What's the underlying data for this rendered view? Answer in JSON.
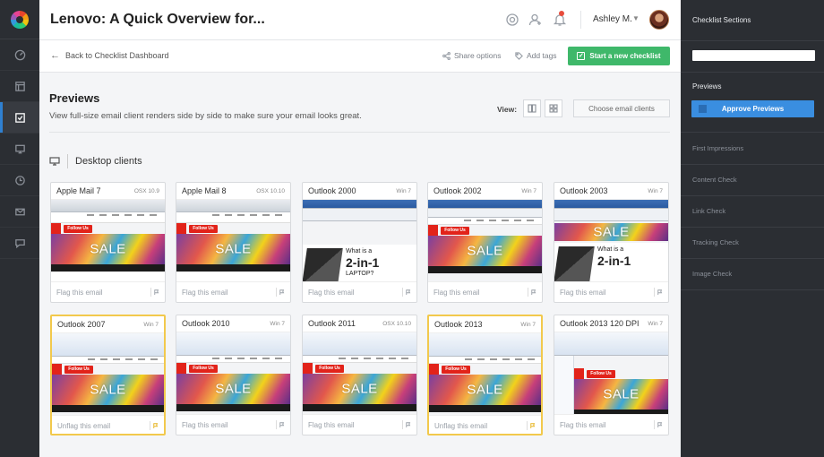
{
  "app": {
    "title": "Lenovo: A Quick Overview for..."
  },
  "header": {
    "user_name": "Ashley M."
  },
  "subbar": {
    "back_label": "Back to Checklist Dashboard",
    "share_label": "Share options",
    "tags_label": "Add tags",
    "start_label": "Start a new checklist"
  },
  "main": {
    "heading": "Previews",
    "description": "View full-size email client renders side by side to make sure your email looks great.",
    "view_label": "View:",
    "choose_label": "Choose email clients",
    "section_label": "Desktop clients"
  },
  "cards": [
    {
      "name": "Apple Mail 7",
      "os": "OSX 10.9",
      "flag": "Flag this email",
      "flagged": false,
      "variant": "mac"
    },
    {
      "name": "Apple Mail 8",
      "os": "OSX 10.10",
      "flag": "Flag this email",
      "flagged": false,
      "variant": "mac"
    },
    {
      "name": "Outlook 2000",
      "os": "Win 7",
      "flag": "Flag this email",
      "flagged": false,
      "variant": "laptop"
    },
    {
      "name": "Outlook 2002",
      "os": "Win 7",
      "flag": "Flag this email",
      "flagged": false,
      "variant": "win"
    },
    {
      "name": "Outlook 2003",
      "os": "Win 7",
      "flag": "Flag this email",
      "flagged": false,
      "variant": "salelaptop"
    },
    {
      "name": "Outlook 2007",
      "os": "Win 7",
      "flag": "Unflag this email",
      "flagged": true,
      "variant": "ribbon"
    },
    {
      "name": "Outlook 2010",
      "os": "Win 7",
      "flag": "Flag this email",
      "flagged": false,
      "variant": "ribbon"
    },
    {
      "name": "Outlook 2011",
      "os": "OSX 10.10",
      "flag": "Flag this email",
      "flagged": false,
      "variant": "ribbon"
    },
    {
      "name": "Outlook 2013",
      "os": "Win 7",
      "flag": "Unflag this email",
      "flagged": true,
      "variant": "ribbon"
    },
    {
      "name": "Outlook 2013 120 DPI",
      "os": "Win 7",
      "flag": "Flag this email",
      "flagged": false,
      "variant": "dpi"
    }
  ],
  "thumb": {
    "follow": "Follow Us",
    "sale": "SALE",
    "laptop_line1": "What is a",
    "laptop_line2": "2-in-1",
    "laptop_line3": "LAPTOP?"
  },
  "sidebar": {
    "title": "Checklist Sections",
    "previews_label": "Previews",
    "approve_label": "Approve Previews",
    "items": [
      "First Impressions",
      "Content Check",
      "Link Check",
      "Tracking Check",
      "Image Check"
    ]
  },
  "colors": {
    "accent": "#3a8ee0",
    "start_green": "#3fb86a",
    "flagged_border": "#f2c94c",
    "rail": "#2b2e33"
  }
}
